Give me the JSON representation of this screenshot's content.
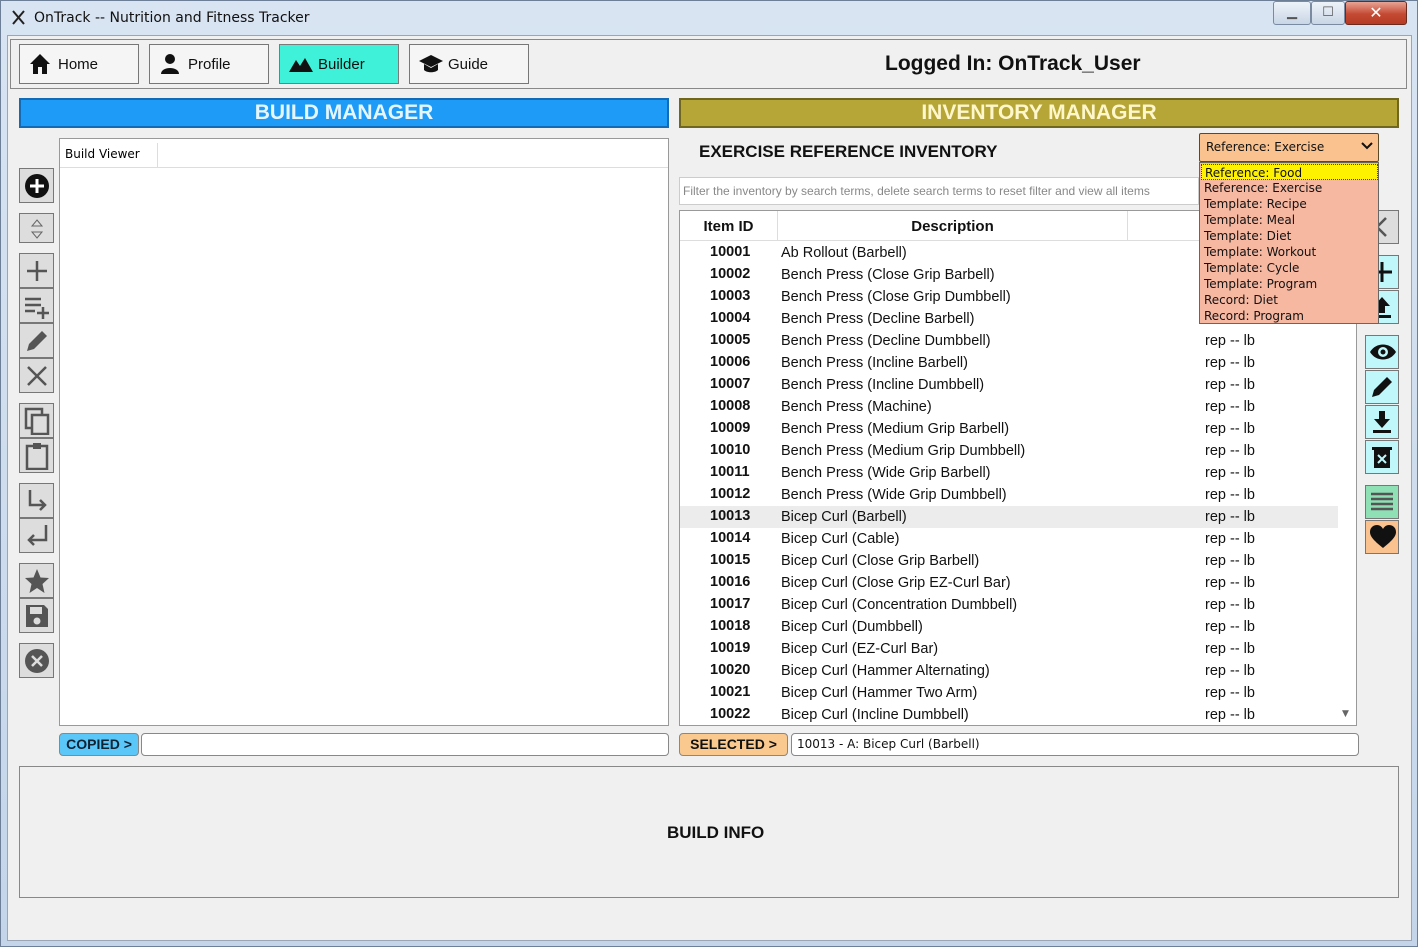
{
  "window": {
    "title": "OnTrack -- Nutrition and Fitness Tracker",
    "app_icon": "fork-knife-icon"
  },
  "nav": {
    "items": [
      {
        "label": "Home",
        "icon": "home-icon"
      },
      {
        "label": "Profile",
        "icon": "user-icon"
      },
      {
        "label": "Builder",
        "icon": "mountains-icon",
        "active": true
      },
      {
        "label": "Guide",
        "icon": "graduation-cap-icon"
      }
    ],
    "logged_in": "Logged In:  OnTrack_User"
  },
  "build": {
    "header": "BUILD MANAGER",
    "viewer_column": "Build Viewer",
    "copied_label": "COPIED >",
    "copied_value": ""
  },
  "inventory": {
    "header": "INVENTORY MANAGER",
    "title": "EXERCISE REFERENCE INVENTORY",
    "filter_placeholder": "Filter the inventory by search terms, delete search terms to reset filter and view all items",
    "columns": [
      "Item ID",
      "Description"
    ],
    "rows": [
      {
        "id": "10001",
        "desc": "Ab Rollout (Barbell)",
        "unit": ""
      },
      {
        "id": "10002",
        "desc": "Bench Press (Close Grip Barbell)",
        "unit": ""
      },
      {
        "id": "10003",
        "desc": "Bench Press (Close Grip Dumbbell)",
        "unit": ""
      },
      {
        "id": "10004",
        "desc": "Bench Press (Decline Barbell)",
        "unit": ""
      },
      {
        "id": "10005",
        "desc": "Bench Press (Decline Dumbbell)",
        "unit": "rep -- lb"
      },
      {
        "id": "10006",
        "desc": "Bench Press (Incline Barbell)",
        "unit": "rep -- lb"
      },
      {
        "id": "10007",
        "desc": "Bench Press (Incline Dumbbell)",
        "unit": "rep -- lb"
      },
      {
        "id": "10008",
        "desc": "Bench Press (Machine)",
        "unit": "rep -- lb"
      },
      {
        "id": "10009",
        "desc": "Bench Press (Medium Grip Barbell)",
        "unit": "rep -- lb"
      },
      {
        "id": "10010",
        "desc": "Bench Press (Medium Grip Dumbbell)",
        "unit": "rep -- lb"
      },
      {
        "id": "10011",
        "desc": "Bench Press (Wide Grip Barbell)",
        "unit": "rep -- lb"
      },
      {
        "id": "10012",
        "desc": "Bench Press (Wide Grip Dumbbell)",
        "unit": "rep -- lb"
      },
      {
        "id": "10013",
        "desc": "Bicep Curl (Barbell)",
        "unit": "rep -- lb"
      },
      {
        "id": "10014",
        "desc": "Bicep Curl (Cable)",
        "unit": "rep -- lb"
      },
      {
        "id": "10015",
        "desc": "Bicep Curl (Close Grip Barbell)",
        "unit": "rep -- lb"
      },
      {
        "id": "10016",
        "desc": "Bicep Curl (Close Grip EZ-Curl Bar)",
        "unit": "rep -- lb"
      },
      {
        "id": "10017",
        "desc": "Bicep Curl (Concentration Dumbbell)",
        "unit": "rep -- lb"
      },
      {
        "id": "10018",
        "desc": "Bicep Curl (Dumbbell)",
        "unit": "rep -- lb"
      },
      {
        "id": "10019",
        "desc": "Bicep Curl (EZ-Curl Bar)",
        "unit": "rep -- lb"
      },
      {
        "id": "10020",
        "desc": "Bicep Curl (Hammer Alternating)",
        "unit": "rep -- lb"
      },
      {
        "id": "10021",
        "desc": "Bicep Curl (Hammer Two Arm)",
        "unit": "rep -- lb"
      },
      {
        "id": "10022",
        "desc": "Bicep Curl (Incline Dumbbell)",
        "unit": "rep -- lb"
      }
    ],
    "selected_row": "10013",
    "selected_label": "SELECTED >",
    "selected_value": "10013 - A: Bicep Curl (Barbell)",
    "dropdown": {
      "value": "Reference: Exercise",
      "highlighted": "Reference: Food",
      "options": [
        "Reference: Food",
        "Reference: Exercise",
        "Template: Recipe",
        "Template: Meal",
        "Template: Diet",
        "Template: Workout",
        "Template: Cycle",
        "Template: Program",
        "Record: Diet",
        "Record: Program"
      ]
    }
  },
  "build_info": {
    "label": "BUILD INFO"
  },
  "colors": {
    "build_header": "#1e9bf7",
    "inventory_header": "#b5a637",
    "builder_active": "#3ff1d8",
    "dropdown_bg": "#f9c28f",
    "dropdown_highlight": "#fff200"
  }
}
